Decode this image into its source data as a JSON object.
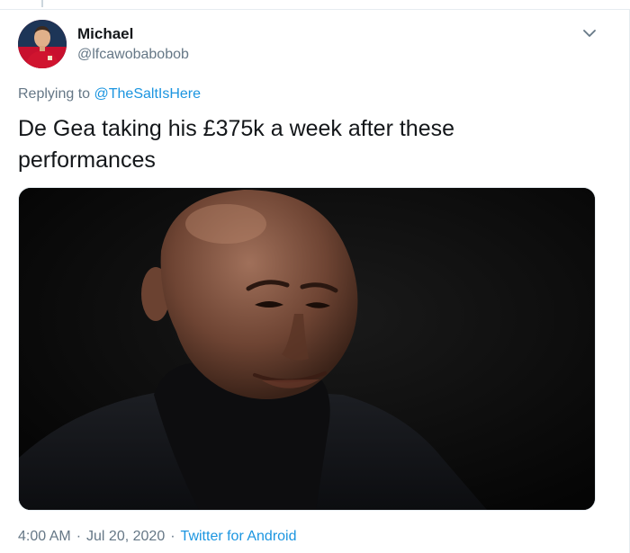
{
  "tweet": {
    "author": {
      "display_name": "Michael",
      "handle": "@lfcawobabobob",
      "avatar_icon": "profile-avatar-footballer"
    },
    "replying_to": {
      "prefix": "Replying to",
      "mention": "@TheSaltIsHere"
    },
    "text": "De Gea taking his £375k a week after these performances",
    "media": {
      "kind": "photo",
      "subject": "smirking bald man in black turtleneck"
    },
    "meta": {
      "time": "4:00 AM",
      "separator": "·",
      "date": "Jul 20, 2020",
      "source": "Twitter for Android"
    },
    "menu_icon": "chevron-down-icon"
  },
  "colors": {
    "link": "#1b95e0",
    "secondary_text": "#657786",
    "primary_text": "#14171a",
    "border": "#e6ecf0",
    "avatar_kit": "#c8102e"
  }
}
